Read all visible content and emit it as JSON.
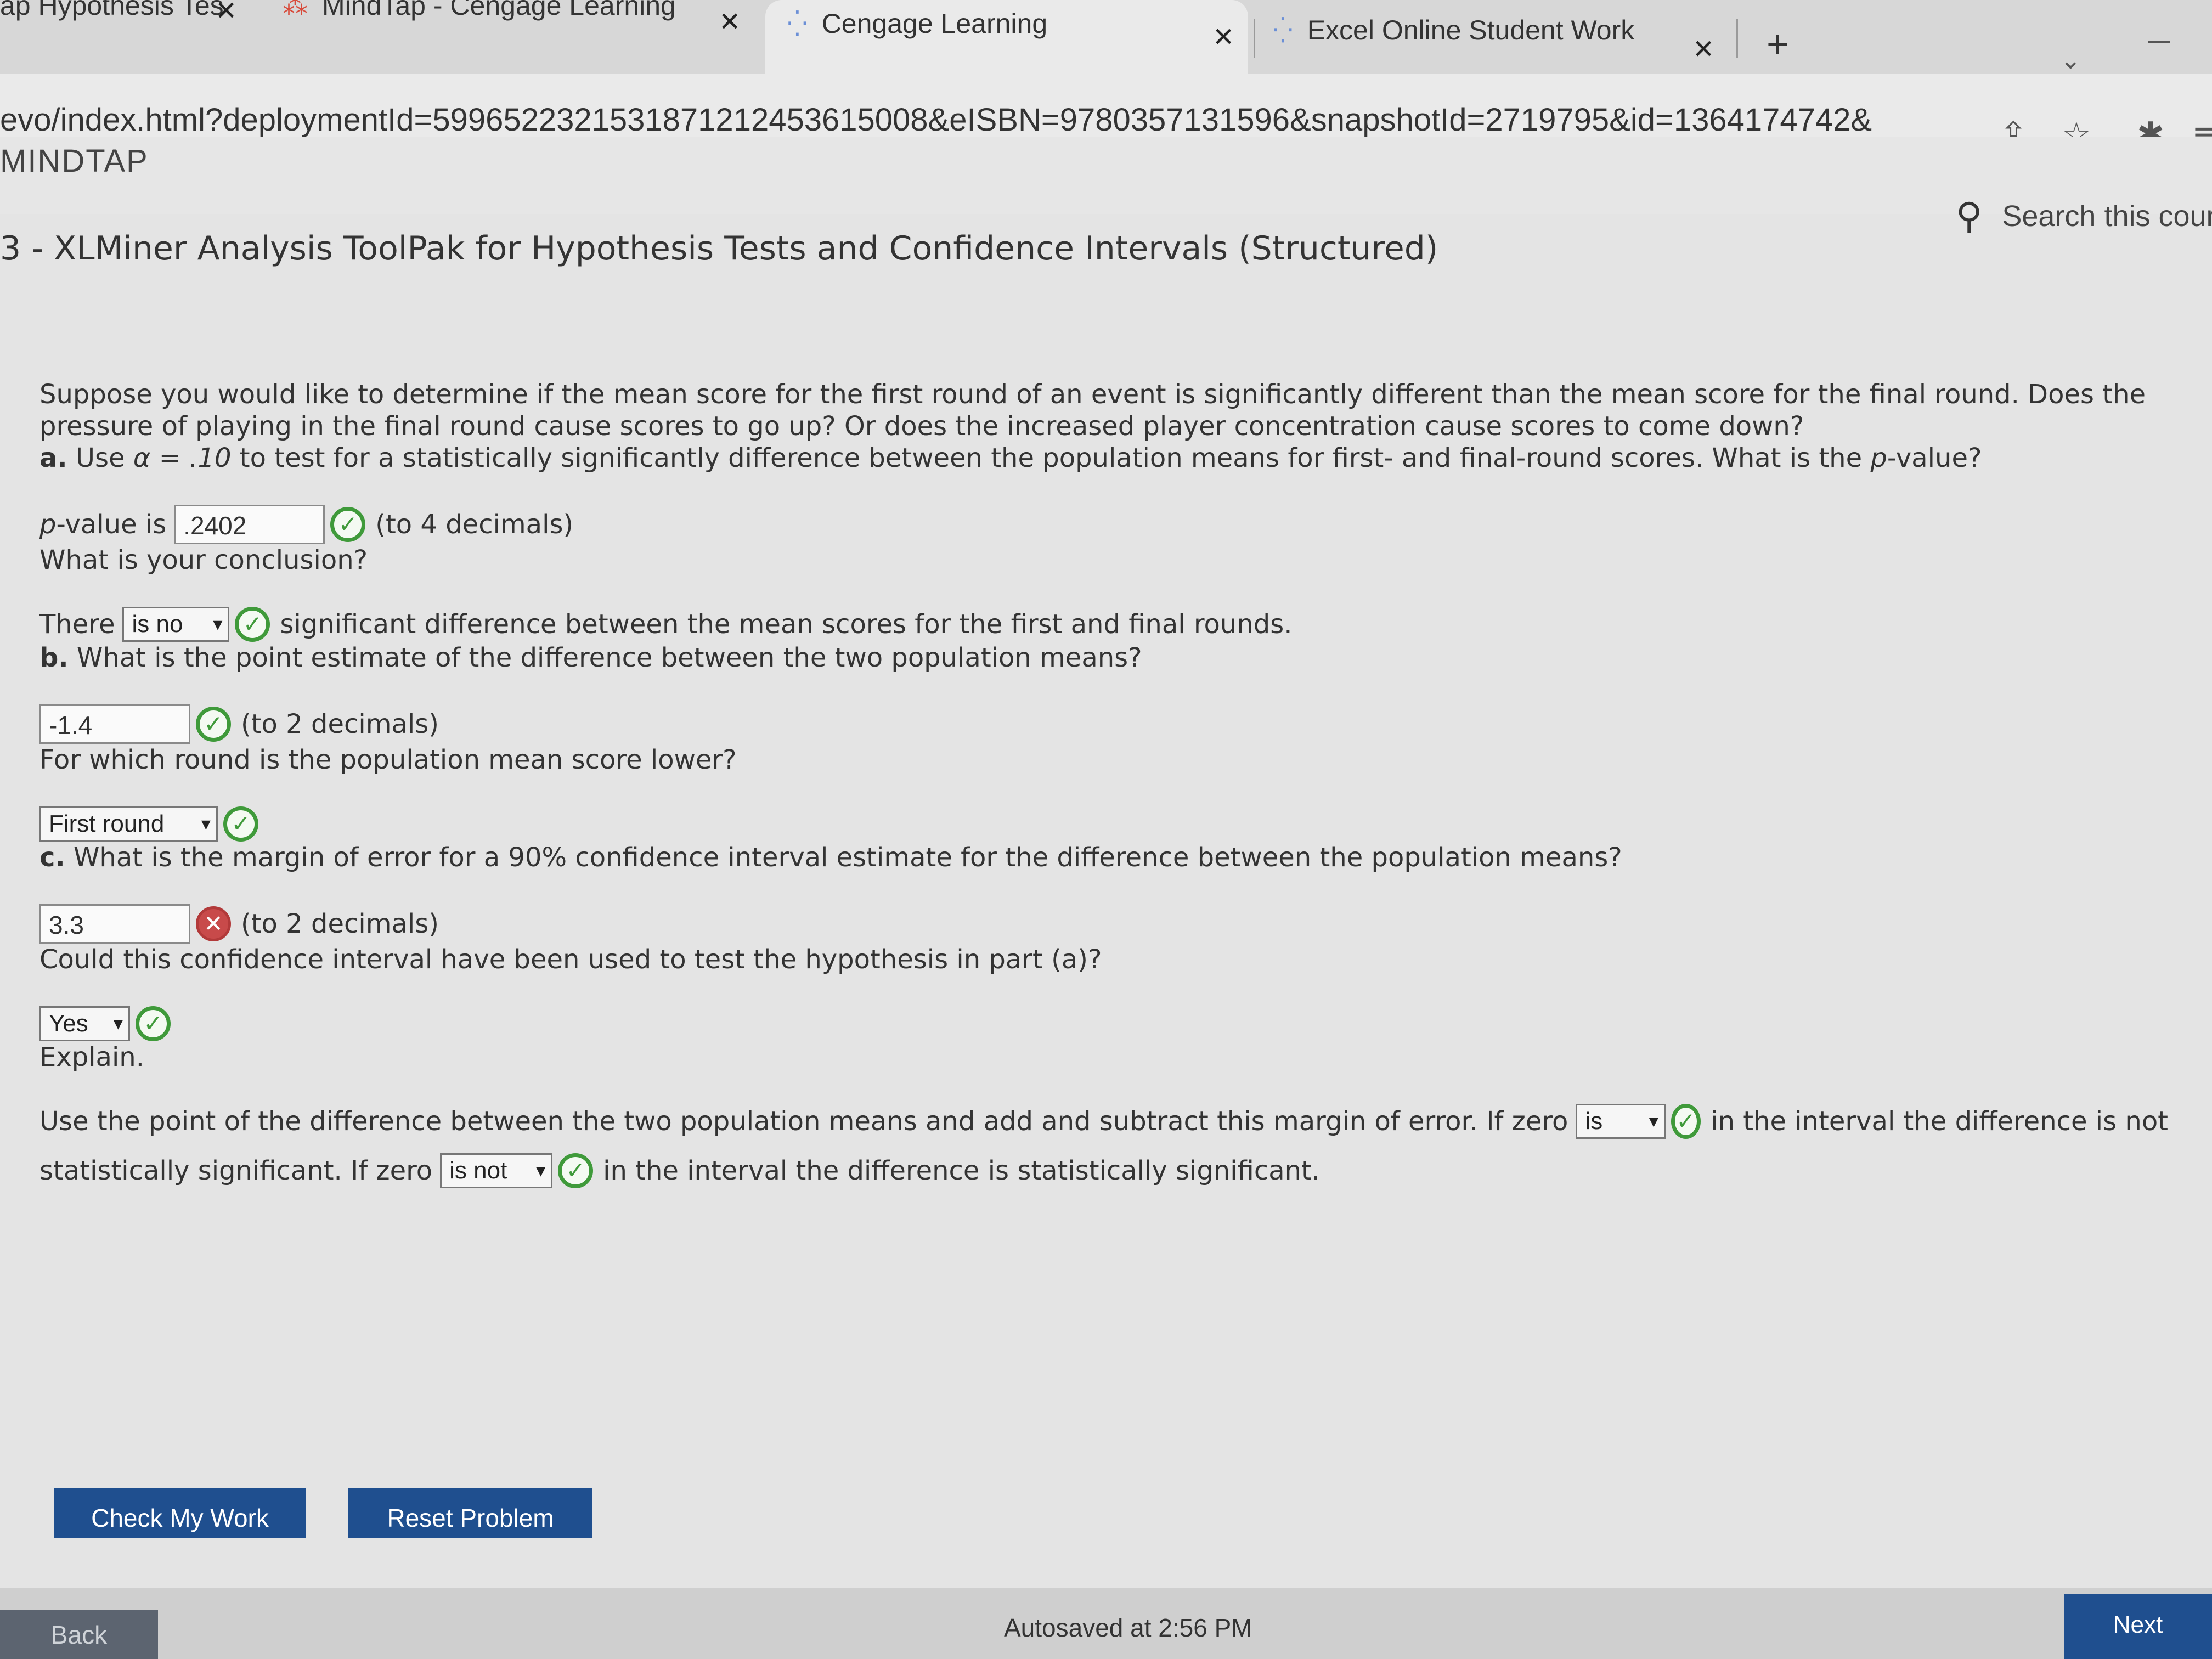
{
  "browser": {
    "tabs": [
      {
        "title": "ap Hypothesis Tes"
      },
      {
        "title": "MindTap - Cengage Learning"
      },
      {
        "title": "Cengage Learning"
      },
      {
        "title": "Excel Online Student Work"
      }
    ],
    "new_tab": "+",
    "url": "evo/index.html?deploymentId=5996522321531871212453615008&eISBN=9780357131596&snapshotId=2719795&id=1364174742&"
  },
  "app": {
    "brand": "MINDTAP",
    "search_text": "Search this cours",
    "breadcrumb": "3 - XLMiner Analysis ToolPak for Hypothesis Tests and Confidence Intervals (Structured)"
  },
  "question": {
    "intro": "Suppose you would like to determine if the mean score for the first round of an event is significantly different than the mean score for the final round. Does the pressure of playing in the final round cause scores to go up? Or does the increased player concentration cause scores to come down?",
    "part_a": {
      "label": "a.",
      "text_pre": "Use ",
      "alpha": "α = .10",
      "text_post": " to test for a statistically significantly difference between the population means for first- and final-round scores. What is the ",
      "p_word": "p",
      "text_end": "-value?",
      "pvalue_p": "p",
      "pvalue_label": "-value is",
      "pvalue": ".2402",
      "pvalue_hint": "(to 4 decimals)",
      "conclusion_q": "What is your conclusion?",
      "there": "There",
      "conclusion_sel": "is no",
      "conclusion_rest": "significant difference between the mean scores for the first and final rounds."
    },
    "part_b": {
      "label": "b.",
      "text": "What is the point estimate of the difference between the two population means?",
      "value": "-1.4",
      "hint": "(to 2 decimals)",
      "round_q": "For which round is the population mean score lower?",
      "round_sel": "First round"
    },
    "part_c": {
      "label": "c.",
      "text": "What is the margin of error for a 90% confidence interval estimate for the difference between the population means?",
      "value": "3.3",
      "hint": "(to 2 decimals)",
      "used_q": "Could this confidence interval have been used to test the hypothesis in part (a)?",
      "used_sel": "Yes",
      "explain": "Explain.",
      "exp1": "Use the point of the difference between the two population means and add and subtract this margin of error. If zero",
      "sel1": "is",
      "exp2": "in the interval the difference is not",
      "exp3": "statistically significant. If zero",
      "sel2": "is not",
      "exp4": "in the interval the difference is statistically significant."
    }
  },
  "buttons": {
    "check": "Check My Work",
    "reset": "Reset Problem",
    "back": "Back",
    "next": "Next"
  },
  "status": {
    "autosave": "Autosaved at 2:56 PM"
  },
  "marks": {
    "correct": "✓",
    "incorrect": "✕"
  },
  "colors": {
    "correct": "#3f9a3a",
    "incorrect": "#c84a4a",
    "primary_button": "#1f4f8f"
  }
}
